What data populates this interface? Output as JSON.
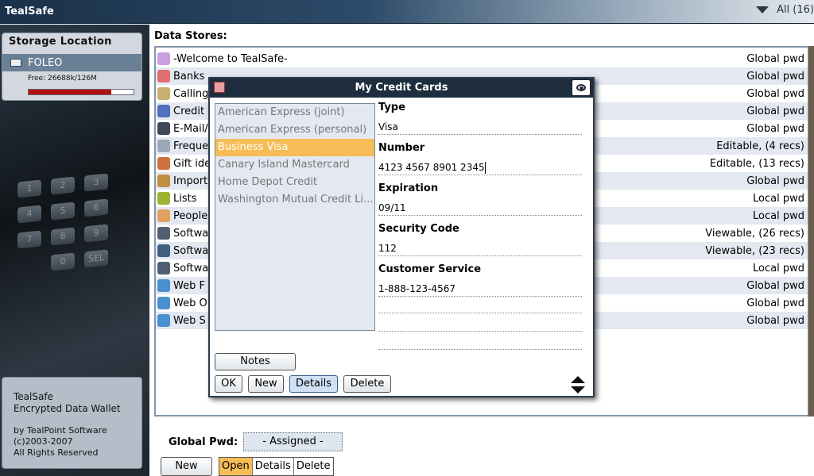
{
  "app": {
    "title": "TealSafe",
    "filter_label": "All (16)"
  },
  "sidebar": {
    "storage_title": "Storage Location",
    "device": "FOLEO",
    "free": "Free: 26688k/126M",
    "usage_fraction": 0.79,
    "about": {
      "line1": "TealSafe",
      "line2": "Encrypted Data Wallet",
      "line3": "by TealPoint Software",
      "line4": "(c)2003-2007",
      "line5": "All Rights Reserved"
    }
  },
  "keypad_keys": [
    "1",
    "2",
    "3",
    "4",
    "5",
    "6",
    "7",
    "8",
    "9",
    "0",
    "SEL"
  ],
  "main": {
    "label": "Data Stores:",
    "stores": [
      {
        "name": "-Welcome to TealSafe-",
        "access": "Global pwd",
        "icon": "welcome-icon",
        "color": "#c8a0e0"
      },
      {
        "name": "Banks",
        "access": "Global pwd",
        "icon": "bank-icon",
        "color": "#e07070"
      },
      {
        "name": "Calling",
        "access": "Global pwd",
        "icon": "phone-icon",
        "color": "#c8b070"
      },
      {
        "name": "Credit",
        "access": "Global pwd",
        "icon": "credit-card-icon",
        "color": "#5070c0"
      },
      {
        "name": "E-Mail/",
        "access": "Global pwd",
        "icon": "laptop-icon",
        "color": "#404858"
      },
      {
        "name": "Freque",
        "access": "Editable, (4 recs)",
        "icon": "airplane-icon",
        "color": "#9aa8b8"
      },
      {
        "name": "Gift ide",
        "access": "Editable, (13 recs)",
        "icon": "people-icon",
        "color": "#d07040"
      },
      {
        "name": "Import",
        "access": "Global pwd",
        "icon": "import-icon",
        "color": "#c09040"
      },
      {
        "name": "Lists",
        "access": "Local pwd",
        "icon": "list-icon",
        "color": "#a0b030"
      },
      {
        "name": "People",
        "access": "Local pwd",
        "icon": "person-icon",
        "color": "#e0a060"
      },
      {
        "name": "Softwa",
        "access": "Viewable, (26 recs)",
        "icon": "handheld-icon",
        "color": "#506070"
      },
      {
        "name": "Softwa",
        "access": "Viewable, (23 recs)",
        "icon": "computer-icon",
        "color": "#406080"
      },
      {
        "name": "Softwa",
        "access": "Local pwd",
        "icon": "handheld-icon",
        "color": "#506070"
      },
      {
        "name": "Web F",
        "access": "Global pwd",
        "icon": "globe-icon",
        "color": "#4a90d0"
      },
      {
        "name": "Web O",
        "access": "Global pwd",
        "icon": "globe-icon",
        "color": "#4a90d0"
      },
      {
        "name": "Web S",
        "access": "Global pwd",
        "icon": "globe-icon",
        "color": "#4a90d0"
      }
    ],
    "global_pwd_label": "Global Pwd:",
    "global_pwd_value": "- Assigned -",
    "buttons": {
      "new": "New",
      "open": "Open",
      "details": "Details",
      "delete": "Delete"
    }
  },
  "dialog": {
    "title": "My Credit Cards",
    "cards": [
      "American Express (joint)",
      "American Express (personal)",
      "Business Visa",
      "Canary Island Mastercard",
      "Home Depot Credit",
      "Washington Mutual Credit Li..."
    ],
    "selected_index": 2,
    "fields": [
      {
        "label": "Type",
        "value": "Visa"
      },
      {
        "label": "Number",
        "value": "4123 4567 8901 2345"
      },
      {
        "label": "Expiration",
        "value": "09/11"
      },
      {
        "label": "Security Code",
        "value": "112"
      },
      {
        "label": "Customer Service",
        "value": "1-888-123-4567"
      }
    ],
    "buttons": {
      "notes": "Notes",
      "ok": "OK",
      "new": "New",
      "details": "Details",
      "delete": "Delete"
    }
  }
}
